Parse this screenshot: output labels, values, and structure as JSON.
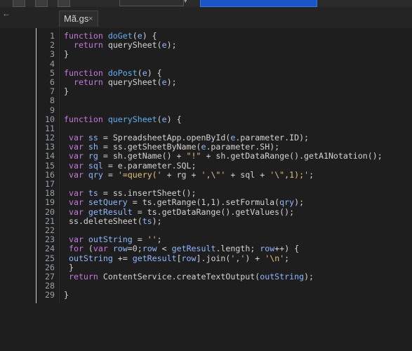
{
  "tab": {
    "label": "Mã.gs",
    "close": "×"
  },
  "toolbar": {
    "chevron": "▾"
  },
  "nav": {
    "arrow": "←"
  },
  "code": [
    [
      {
        "t": "function ",
        "c": "k"
      },
      {
        "t": "doGet",
        "c": "f"
      },
      {
        "t": "(",
        "c": "p"
      },
      {
        "t": "e",
        "c": "v"
      },
      {
        "t": ") {",
        "c": "p"
      }
    ],
    [
      {
        "t": "  ",
        "c": "p"
      },
      {
        "t": "return ",
        "c": "k"
      },
      {
        "t": "querySheet",
        "c": "p"
      },
      {
        "t": "(",
        "c": "p"
      },
      {
        "t": "e",
        "c": "v"
      },
      {
        "t": ");",
        "c": "p"
      }
    ],
    [
      {
        "t": "}",
        "c": "p"
      }
    ],
    [],
    [
      {
        "t": "function ",
        "c": "k"
      },
      {
        "t": "doPost",
        "c": "f"
      },
      {
        "t": "(",
        "c": "p"
      },
      {
        "t": "e",
        "c": "v"
      },
      {
        "t": ") {",
        "c": "p"
      }
    ],
    [
      {
        "t": "  ",
        "c": "p"
      },
      {
        "t": "return ",
        "c": "k"
      },
      {
        "t": "querySheet",
        "c": "p"
      },
      {
        "t": "(",
        "c": "p"
      },
      {
        "t": "e",
        "c": "v"
      },
      {
        "t": ");",
        "c": "p"
      }
    ],
    [
      {
        "t": "}",
        "c": "p"
      }
    ],
    [],
    [],
    [
      {
        "t": "function ",
        "c": "k"
      },
      {
        "t": "querySheet",
        "c": "f"
      },
      {
        "t": "(",
        "c": "p"
      },
      {
        "t": "e",
        "c": "v"
      },
      {
        "t": ") {",
        "c": "p"
      }
    ],
    [],
    [
      {
        "t": " ",
        "c": "p"
      },
      {
        "t": "var ",
        "c": "k"
      },
      {
        "t": "ss",
        "c": "v"
      },
      {
        "t": " = SpreadsheetApp.openById(",
        "c": "p"
      },
      {
        "t": "e",
        "c": "v"
      },
      {
        "t": ".parameter.ID);",
        "c": "p"
      }
    ],
    [
      {
        "t": " ",
        "c": "p"
      },
      {
        "t": "var ",
        "c": "k"
      },
      {
        "t": "sh",
        "c": "v"
      },
      {
        "t": " = ss.getSheetByName(",
        "c": "p"
      },
      {
        "t": "e",
        "c": "v"
      },
      {
        "t": ".parameter.SH);",
        "c": "p"
      }
    ],
    [
      {
        "t": " ",
        "c": "p"
      },
      {
        "t": "var ",
        "c": "k"
      },
      {
        "t": "rg",
        "c": "v"
      },
      {
        "t": " = sh.getName() + ",
        "c": "p"
      },
      {
        "t": "\"!\"",
        "c": "s"
      },
      {
        "t": " + sh.getDataRange().getA1Notation();",
        "c": "p"
      }
    ],
    [
      {
        "t": " ",
        "c": "p"
      },
      {
        "t": "var ",
        "c": "k"
      },
      {
        "t": "sql",
        "c": "v"
      },
      {
        "t": " = e.parameter.SQL;",
        "c": "p"
      }
    ],
    [
      {
        "t": " ",
        "c": "p"
      },
      {
        "t": "var ",
        "c": "k"
      },
      {
        "t": "qry",
        "c": "v"
      },
      {
        "t": " = ",
        "c": "p"
      },
      {
        "t": "'=query('",
        "c": "s"
      },
      {
        "t": " + rg + ",
        "c": "p"
      },
      {
        "t": "',\\\"'",
        "c": "s"
      },
      {
        "t": " + sql + ",
        "c": "p"
      },
      {
        "t": "'\\\",1);'",
        "c": "s"
      },
      {
        "t": ";",
        "c": "p"
      }
    ],
    [],
    [
      {
        "t": " ",
        "c": "p"
      },
      {
        "t": "var ",
        "c": "k"
      },
      {
        "t": "ts",
        "c": "v"
      },
      {
        "t": " = ss.insertSheet();",
        "c": "p"
      }
    ],
    [
      {
        "t": " ",
        "c": "p"
      },
      {
        "t": "var ",
        "c": "k"
      },
      {
        "t": "setQuery",
        "c": "v"
      },
      {
        "t": " = ts.getRange(1,1).setFormula(",
        "c": "p"
      },
      {
        "t": "qry",
        "c": "v"
      },
      {
        "t": ");",
        "c": "p"
      }
    ],
    [
      {
        "t": " ",
        "c": "p"
      },
      {
        "t": "var ",
        "c": "k"
      },
      {
        "t": "getResult",
        "c": "v"
      },
      {
        "t": " = ts.getDataRange().getValues();",
        "c": "p"
      }
    ],
    [
      {
        "t": " ss.deleteSheet(",
        "c": "p"
      },
      {
        "t": "ts",
        "c": "v"
      },
      {
        "t": ");",
        "c": "p"
      }
    ],
    [],
    [
      {
        "t": " ",
        "c": "p"
      },
      {
        "t": "var ",
        "c": "k"
      },
      {
        "t": "outString",
        "c": "v"
      },
      {
        "t": " = ",
        "c": "p"
      },
      {
        "t": "''",
        "c": "s"
      },
      {
        "t": ";",
        "c": "p"
      }
    ],
    [
      {
        "t": " ",
        "c": "p"
      },
      {
        "t": "for ",
        "c": "k"
      },
      {
        "t": "(",
        "c": "p"
      },
      {
        "t": "var ",
        "c": "k"
      },
      {
        "t": "row",
        "c": "v"
      },
      {
        "t": "=0;",
        "c": "p"
      },
      {
        "t": "row",
        "c": "v"
      },
      {
        "t": " < ",
        "c": "p"
      },
      {
        "t": "getResult",
        "c": "v"
      },
      {
        "t": ".length; ",
        "c": "p"
      },
      {
        "t": "row",
        "c": "v"
      },
      {
        "t": "++) {",
        "c": "p"
      }
    ],
    [
      {
        "t": " ",
        "c": "p"
      },
      {
        "t": "outString",
        "c": "v"
      },
      {
        "t": " += ",
        "c": "p"
      },
      {
        "t": "getResult",
        "c": "v"
      },
      {
        "t": "[",
        "c": "p"
      },
      {
        "t": "row",
        "c": "v"
      },
      {
        "t": "].join(",
        "c": "p"
      },
      {
        "t": "','",
        "c": "s"
      },
      {
        "t": ") + ",
        "c": "p"
      },
      {
        "t": "'\\n'",
        "c": "s"
      },
      {
        "t": ";",
        "c": "p"
      }
    ],
    [
      {
        "t": " }",
        "c": "p"
      }
    ],
    [
      {
        "t": " ",
        "c": "p"
      },
      {
        "t": "return ",
        "c": "k"
      },
      {
        "t": "ContentService.createTextOutput(",
        "c": "p"
      },
      {
        "t": "outString",
        "c": "v"
      },
      {
        "t": ");",
        "c": "p"
      }
    ],
    [],
    [
      {
        "t": "}",
        "c": "p"
      }
    ]
  ]
}
